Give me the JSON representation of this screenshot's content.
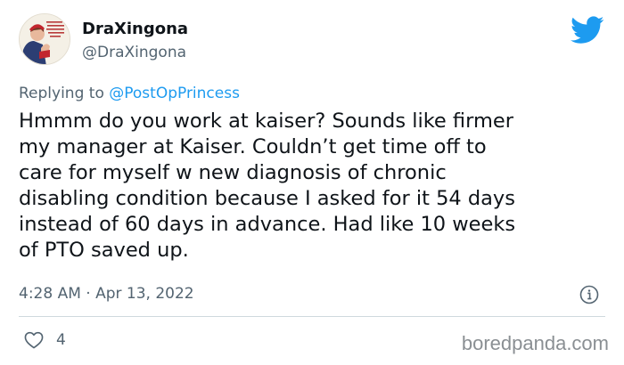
{
  "colors": {
    "accent": "#1d9bf0",
    "text_primary": "#0f1419",
    "text_secondary": "#536471",
    "divider": "#cfd9de"
  },
  "author": {
    "display_name": "DraXingona",
    "handle": "@DraXingona",
    "avatar_icon": "avatar-image"
  },
  "platform_icon": "twitter-bird-icon",
  "reply": {
    "prefix": "Replying to",
    "mention": "@PostOpPrincess"
  },
  "tweet": {
    "lines": [
      "Hmmm do you work at kaiser? Sounds like firmer",
      "my manager at Kaiser. Couldn’t get time off to",
      "care for myself w new diagnosis of chronic",
      "disabling condition because I asked for it 54 days",
      "instead of 60 days in advance. Had like 10 weeks",
      "of PTO saved up."
    ],
    "timestamp": "4:28 AM · Apr 13, 2022"
  },
  "engagement": {
    "like_icon": "heart-icon",
    "likes": "4"
  },
  "info_icon": "info-icon",
  "watermark": "boredpanda.com"
}
